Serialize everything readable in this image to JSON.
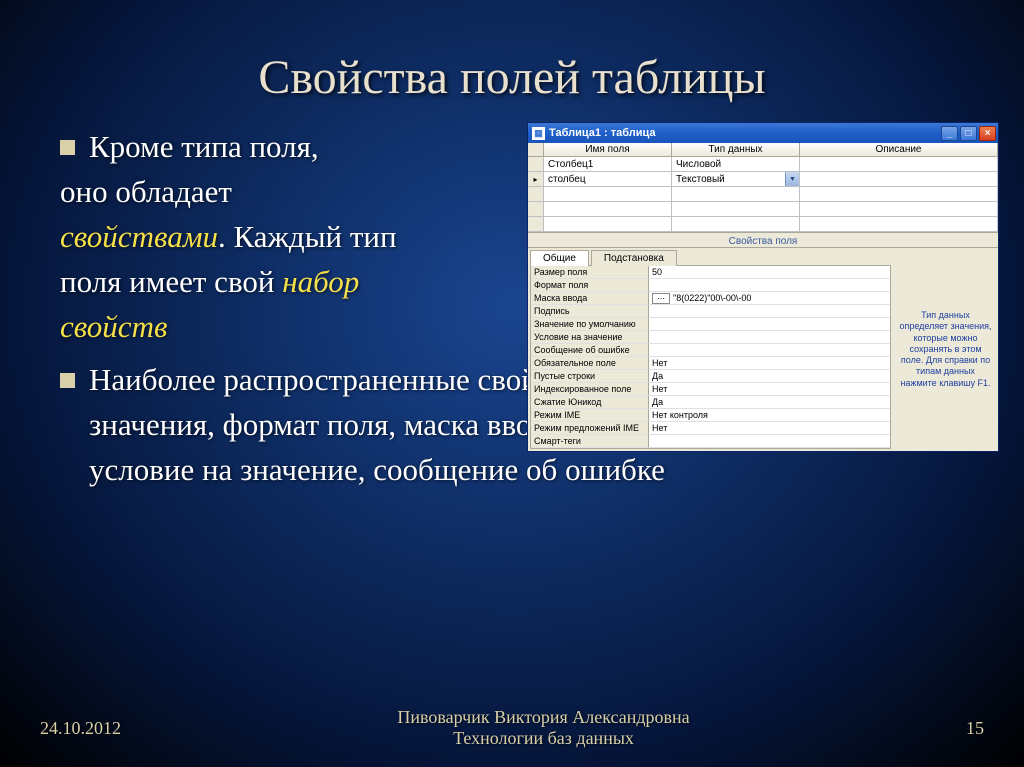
{
  "slide": {
    "title": "Свойства полей таблицы",
    "bullets": [
      {
        "pre": "Кроме типа поля,",
        "line2_a": "оно обладает",
        "line3_em": "свойствами",
        "line3_b": ". Каждый тип",
        "line4_a": "поля имеет свой ",
        "line4_em": "набор",
        "line5_em": "свойств"
      },
      {
        "text": "Наиболее распространенные свойства: размер поля, новые значения, формат поля, маска ввода, значение по умолчанию, условие на значение, сообщение об ошибке"
      }
    ],
    "footer_date": "24.10.2012",
    "footer_author": "Пивоварчик Виктория Александровна",
    "footer_subj": "Технологии баз данных",
    "footer_page": "15"
  },
  "window": {
    "title": "Таблица1 : таблица",
    "columns": {
      "c1": "Имя поля",
      "c2": "Тип данных",
      "c3": "Описание"
    },
    "rows": [
      {
        "name": "Столбец1",
        "type": "Числовой"
      },
      {
        "name": "столбец",
        "type": "Текстовый"
      }
    ],
    "section": "Свойства поля",
    "tabs": {
      "general": "Общие",
      "lookup": "Подстановка"
    },
    "props": [
      {
        "label": "Размер поля",
        "value": "50"
      },
      {
        "label": "Формат поля",
        "value": ""
      },
      {
        "label": "Маска ввода",
        "value": "\"8(0222)\"00\\-00\\-00",
        "mask": true
      },
      {
        "label": "Подпись",
        "value": ""
      },
      {
        "label": "Значение по умолчанию",
        "value": ""
      },
      {
        "label": "Условие на значение",
        "value": ""
      },
      {
        "label": "Сообщение об ошибке",
        "value": ""
      },
      {
        "label": "Обязательное поле",
        "value": "Нет"
      },
      {
        "label": "Пустые строки",
        "value": "Да"
      },
      {
        "label": "Индексированное поле",
        "value": "Нет"
      },
      {
        "label": "Сжатие Юникод",
        "value": "Да"
      },
      {
        "label": "Режим IME",
        "value": "Нет контроля"
      },
      {
        "label": "Режим предложений IME",
        "value": "Нет"
      },
      {
        "label": "Смарт-теги",
        "value": ""
      }
    ],
    "hint": "Тип данных определяет значения, которые можно сохранять в этом поле. Для справки по типам данных нажмите клавишу F1."
  }
}
